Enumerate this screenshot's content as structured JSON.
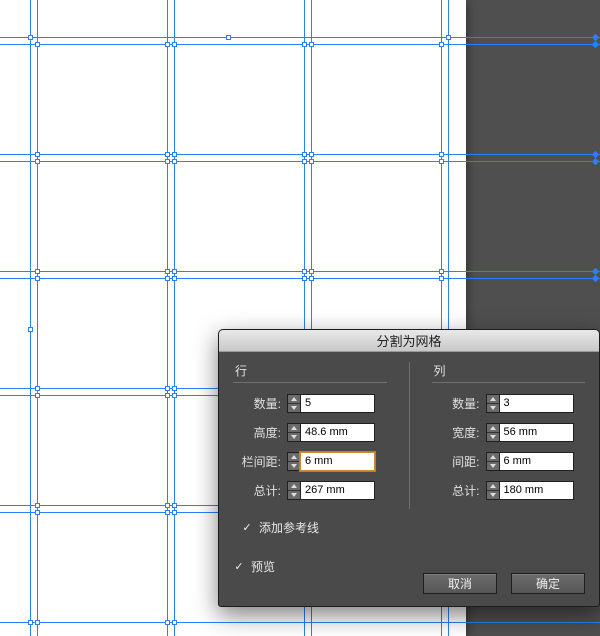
{
  "dialog": {
    "title": "分割为网格",
    "rows_group": {
      "title": "行",
      "count_label": "数量:",
      "count_value": "5",
      "height_label": "高度:",
      "height_value": "48.6 mm",
      "gutter_label": "栏间距:",
      "gutter_value": "6 mm",
      "total_label": "总计:",
      "total_value": "267 mm"
    },
    "cols_group": {
      "title": "列",
      "count_label": "数量:",
      "count_value": "3",
      "width_label": "宽度:",
      "width_value": "56 mm",
      "gutter_label": "间距:",
      "gutter_value": "6 mm",
      "total_label": "总计:",
      "total_value": "180 mm"
    },
    "add_guides_label": "添加参考线",
    "preview_label": "预览",
    "cancel_label": "取消",
    "ok_label": "确定"
  }
}
